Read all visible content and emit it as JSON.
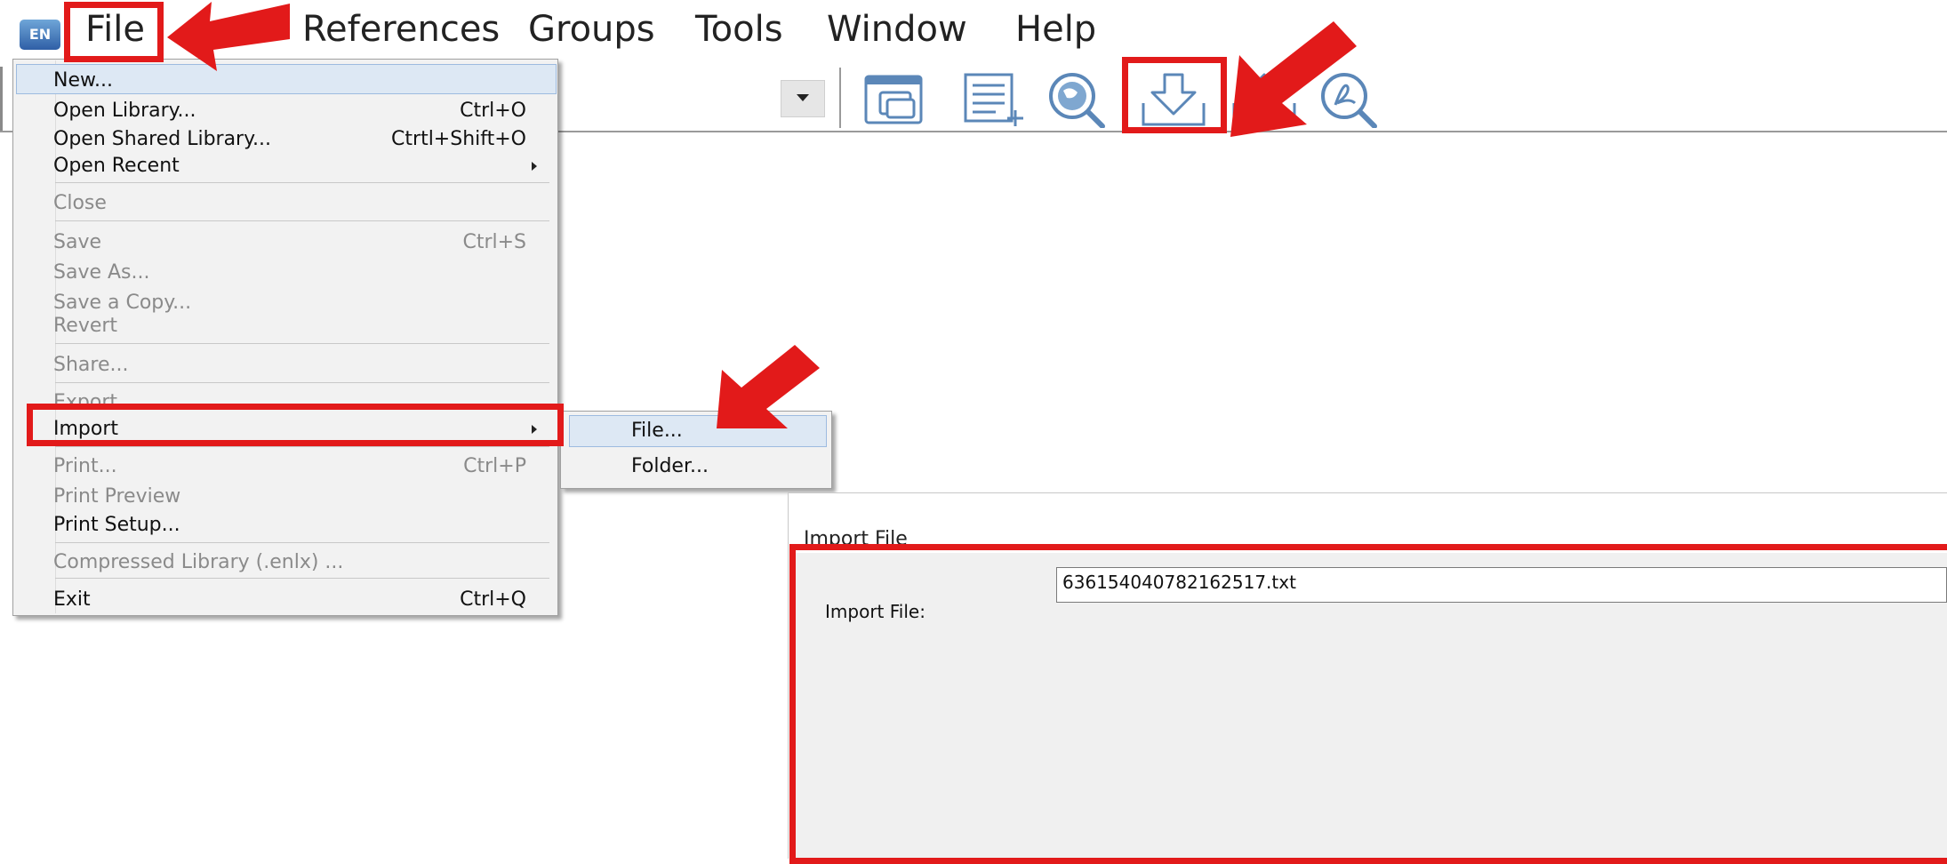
{
  "menubar": {
    "app_icon_text": "EN",
    "items": [
      "File",
      "References",
      "Groups",
      "Tools",
      "Window",
      "Help"
    ]
  },
  "toolbar": {
    "icons": [
      "copy-window-icon",
      "new-reference-icon",
      "online-search-icon",
      "import-icon",
      "export-icon",
      "find-pdf-icon"
    ]
  },
  "file_menu": {
    "items": [
      {
        "label": "New...",
        "shortcut": "",
        "enabled": true
      },
      {
        "label": "Open Library...",
        "shortcut": "Ctrl+O",
        "enabled": true
      },
      {
        "label": "Open Shared Library...",
        "shortcut": "Ctrtl+Shift+O",
        "enabled": true
      },
      {
        "label": "Open Recent",
        "shortcut": "",
        "enabled": true
      },
      {
        "label": "Close",
        "shortcut": "",
        "enabled": false
      },
      {
        "label": "Save",
        "shortcut": "Ctrl+S",
        "enabled": false
      },
      {
        "label": "Save As...",
        "shortcut": "",
        "enabled": false
      },
      {
        "label": "Save a Copy...",
        "shortcut": "",
        "enabled": false
      },
      {
        "label": "Revert",
        "shortcut": "",
        "enabled": false
      },
      {
        "label": "Share...",
        "shortcut": "",
        "enabled": false
      },
      {
        "label": "Export",
        "shortcut": "",
        "enabled": false
      },
      {
        "label": "Import",
        "shortcut": "",
        "enabled": true
      },
      {
        "label": "Print...",
        "shortcut": "Ctrl+P",
        "enabled": false
      },
      {
        "label": "Print Preview",
        "shortcut": "",
        "enabled": false
      },
      {
        "label": "Print Setup...",
        "shortcut": "",
        "enabled": true
      },
      {
        "label": "Compressed Library (.enlx) ...",
        "shortcut": "",
        "enabled": false
      },
      {
        "label": "Exit",
        "shortcut": "Ctrl+Q",
        "enabled": true
      }
    ]
  },
  "import_submenu": {
    "items": [
      "File...",
      "Folder..."
    ]
  },
  "import_dialog": {
    "title": "Import File",
    "field_label": "Import File:",
    "field_value": "636154040782162517.txt"
  },
  "colors": {
    "annotation_red": "#e21a1a",
    "menu_highlight": "#dde8f4",
    "disabled_text": "#8a8a8a"
  }
}
